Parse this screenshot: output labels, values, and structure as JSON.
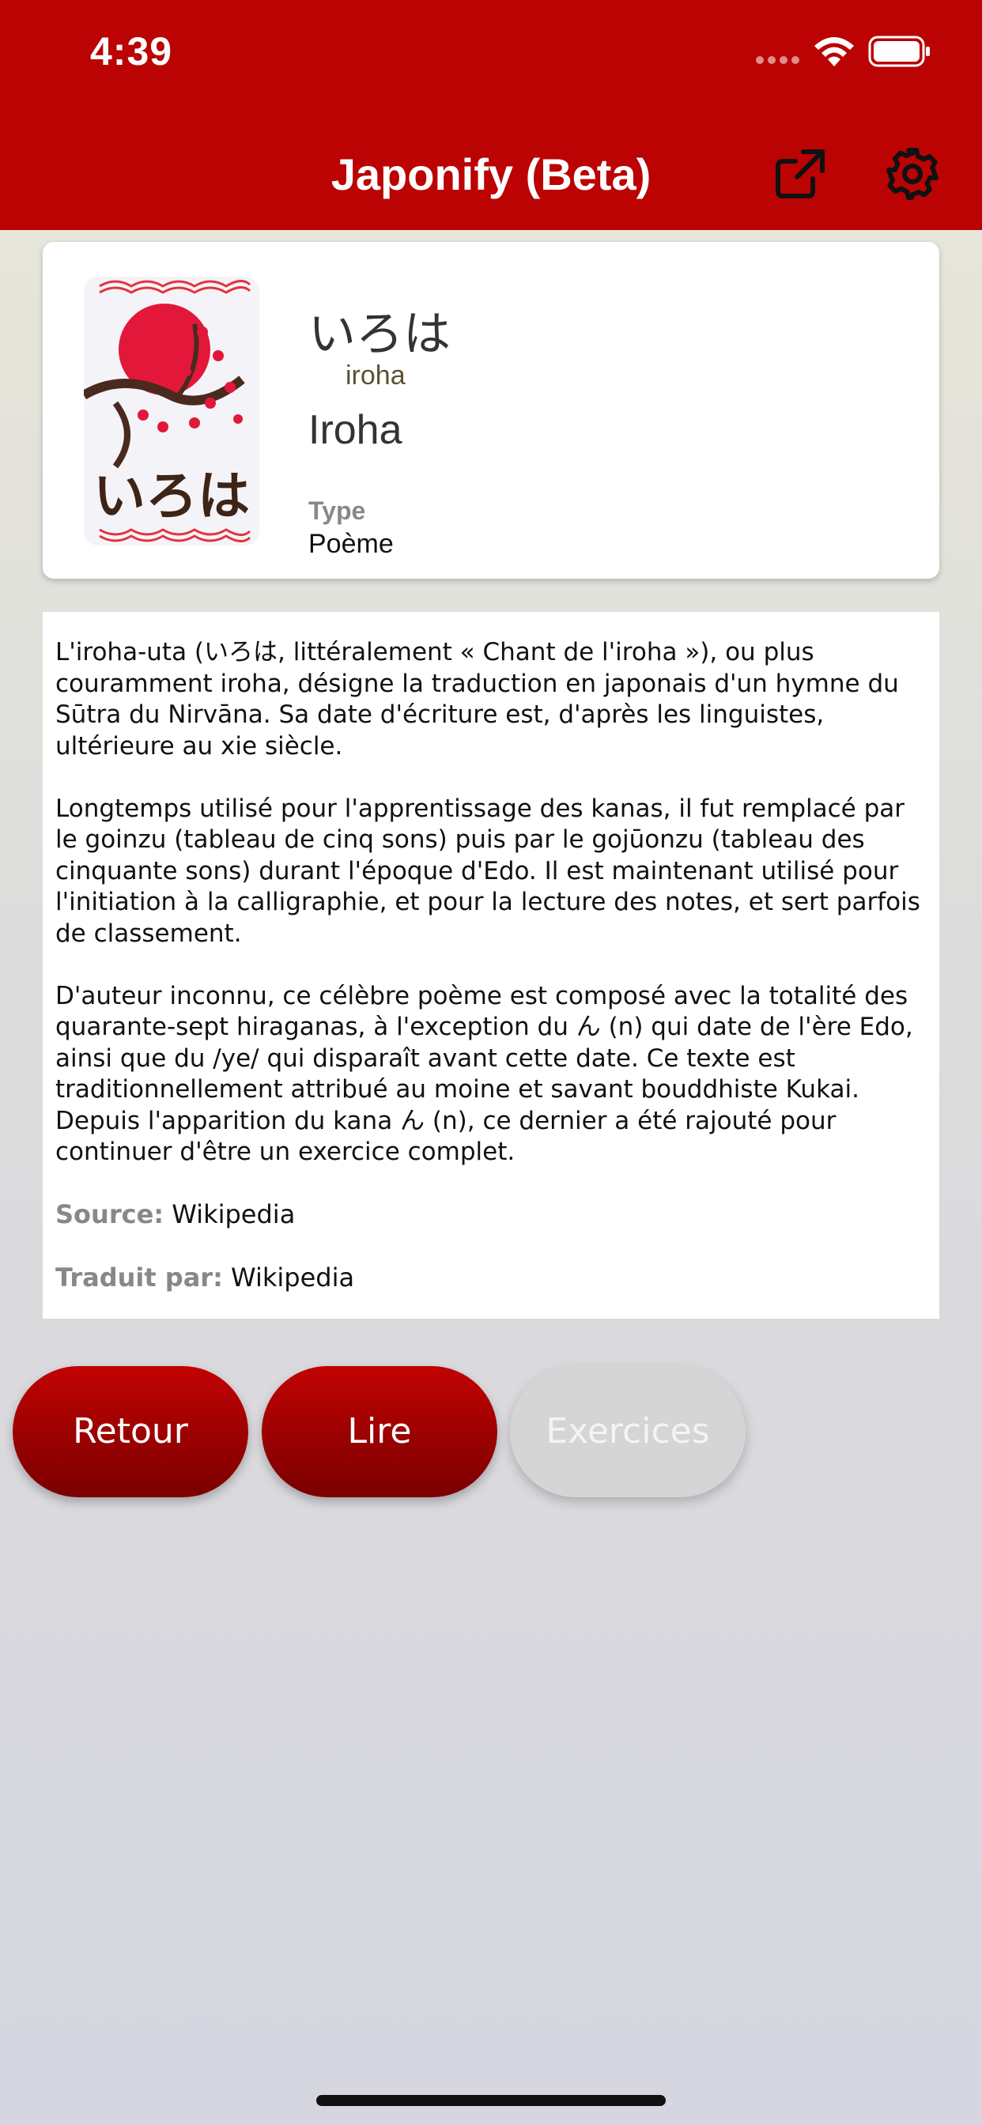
{
  "status_bar": {
    "time": "4:39"
  },
  "header": {
    "title": "Japonify (Beta)",
    "share_icon": "external-link-icon",
    "settings_icon": "gear-icon",
    "color": "#bb0303"
  },
  "card": {
    "image_icon": "iroha-illustration",
    "image_caption": "いろは",
    "japanese_title": "いろは",
    "romaji": "iroha",
    "french_title": "Iroha",
    "type_label": "Type",
    "type_value": "Poème"
  },
  "description": {
    "paragraphs": [
      "L'iroha-uta (いろは, littéralement « Chant de l'iroha »), ou plus couramment iroha, désigne la traduction en japonais d'un hymne du Sūtra du Nirvāna. Sa date d'écriture est, d'après les linguistes, ultérieure au xie siècle.",
      "Longtemps utilisé pour l'apprentissage des kanas, il fut remplacé par le goinzu (tableau de cinq sons) puis par le gojūonzu (tableau des cinquante sons) durant l'époque d'Edo. Il est maintenant utilisé pour l'initiation à la calligraphie, et pour la lecture des notes, et sert parfois de classement.",
      "D'auteur inconnu, ce célèbre poème est composé avec la totalité des quarante-sept hiraganas, à l'exception du ん (n) qui date de l'ère Edo, ainsi que du /ye/ qui disparaît avant cette date. Ce texte est traditionnellement attribué au moine et savant bouddhiste Kukai. Depuis l'apparition du kana ん (n), ce dernier a été rajouté pour continuer d'être un exercice complet."
    ],
    "source_label": "Source:",
    "source_value": "Wikipedia",
    "translated_label": "Traduit par:",
    "translated_value": "Wikipedia"
  },
  "buttons": {
    "back": "Retour",
    "read": "Lire",
    "exercises": "Exercices"
  }
}
